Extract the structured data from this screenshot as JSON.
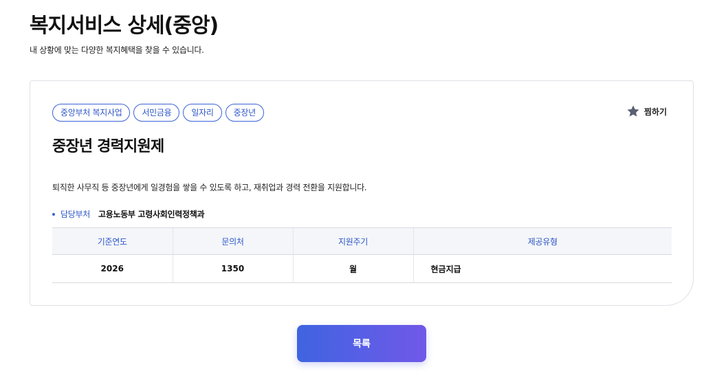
{
  "header": {
    "title": "복지서비스 상세(중앙)",
    "subtitle": "내 상황에 맞는 다양한 복지혜택을 찾을 수 있습니다."
  },
  "service": {
    "tags": [
      "중앙부처 복지사업",
      "서민금융",
      "일자리",
      "중장년"
    ],
    "bookmark_label": "찜하기",
    "bookmark_icon": "star-icon",
    "title": "중장년 경력지원제",
    "description": "퇴직한 사무직 등 중장년에게 일경험을 쌓을 수 있도록 하고, 재취업과 경력 전환을 지원합니다.",
    "department": {
      "label": "담당부처",
      "value": "고용노동부 고령사회인력정책과"
    },
    "table": {
      "headers": [
        "기준연도",
        "문의처",
        "지원주기",
        "제공유형"
      ],
      "row": [
        "2026",
        "1350",
        "월",
        "현금지급"
      ]
    }
  },
  "footer": {
    "list_button_label": "목록"
  },
  "colors": {
    "accent": "#3a62d7",
    "button_start": "#3f64e0",
    "button_end": "#7158e8",
    "table_header_bg": "#f4f6f9"
  }
}
